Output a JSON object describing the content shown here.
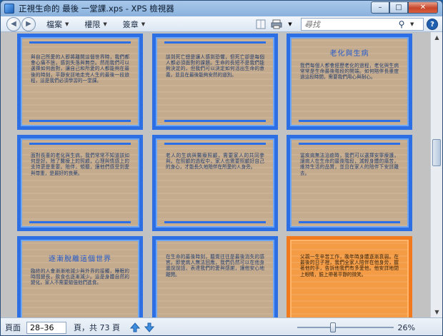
{
  "window": {
    "title": "正視生命的 最後 一堂課.xps - XPS 檢視器",
    "buttons": {
      "minimize": "–",
      "maximize": "□",
      "close": "✕"
    }
  },
  "toolbar": {
    "menus": [
      "檔案",
      "權限",
      "簽章"
    ],
    "search_placeholder": "尋找",
    "help": "?"
  },
  "pages": [
    {
      "id": "p1",
      "heading": "",
      "text": "與自己所愛的人即將離開這個世界時，我們都會心痛不捨，感到失落與無奈。然而我們可以選擇如何面對，讓自己和所愛的人都能夠在最後的時刻，平靜安詳地走完人生的最後一段旅程，這是我們必須學習的一堂課。"
    },
    {
      "id": "p2",
      "heading": "",
      "text": "談到死亡總是讓人感到恐懼，但死亡卻是每個人都必須面對的課題。生命的長短不是我們能夠決定的，但我們可以決定如何活出生命的意義，並且在最後能夠安然的道別。"
    },
    {
      "id": "p3",
      "heading": "老化與生病",
      "text": "我們每個人都會經歷老化的過程，老化與生病常常是生命最後階段的開端。如何陪伴長輩度過這段時間，需要我們用心與耐心。"
    },
    {
      "id": "p4",
      "heading": "",
      "text": "面對長輩的老化與生病，我們常常不知道該如何是好。除了醫療上的照顧，心理與情感上的支持更是重要。陪伴，傾聽，讓他們感受到愛與尊重，是最好的良藥。"
    },
    {
      "id": "p5",
      "heading": "",
      "text": "老人的生病與醫療照顧，需要家人的共同參與。在照顧的過程中，家人也需要照顧好自己的身心，才能長久地陪伴在所愛的人身旁。"
    },
    {
      "id": "p6",
      "heading": "",
      "text": "當疾病無法治癒時，我們可以選擇安寧療護，讓病人在生命的最後階段，減輕身體的痛苦，維持生活的品質，並且在家人的陪伴下安詳離去。"
    },
    {
      "id": "p7",
      "heading": "逐漸脫離這個世界",
      "text": "臨終的人會漸漸地減少與外界的接觸，睡眠的時間變長，飲食也逐漸減少。這是身體自然的變化，家人不需要勉強他們進食。"
    },
    {
      "id": "p8",
      "heading": "",
      "text": "在生命的最後時刻，聽覺往往是最後消失的感官。即使病人無法回應，我們仍然可以在他身邊說說話，表達我們的愛與感謝，讓他安心地離開。"
    },
    {
      "id": "p9",
      "heading": "",
      "text": "父親一生辛苦工作，晚年時身體逐漸衰弱。在最後的日子裡，我們全家人陪伴在他身旁，握著他的手，告訴他我們有多愛他。他安詳地閉上眼睛，臉上帶著平靜的微笑。"
    }
  ],
  "status": {
    "page_label": "頁面",
    "page_range": "28–36",
    "page_total": "頁，共 73 頁",
    "zoom": "26%",
    "zoom_level": 0.26
  }
}
